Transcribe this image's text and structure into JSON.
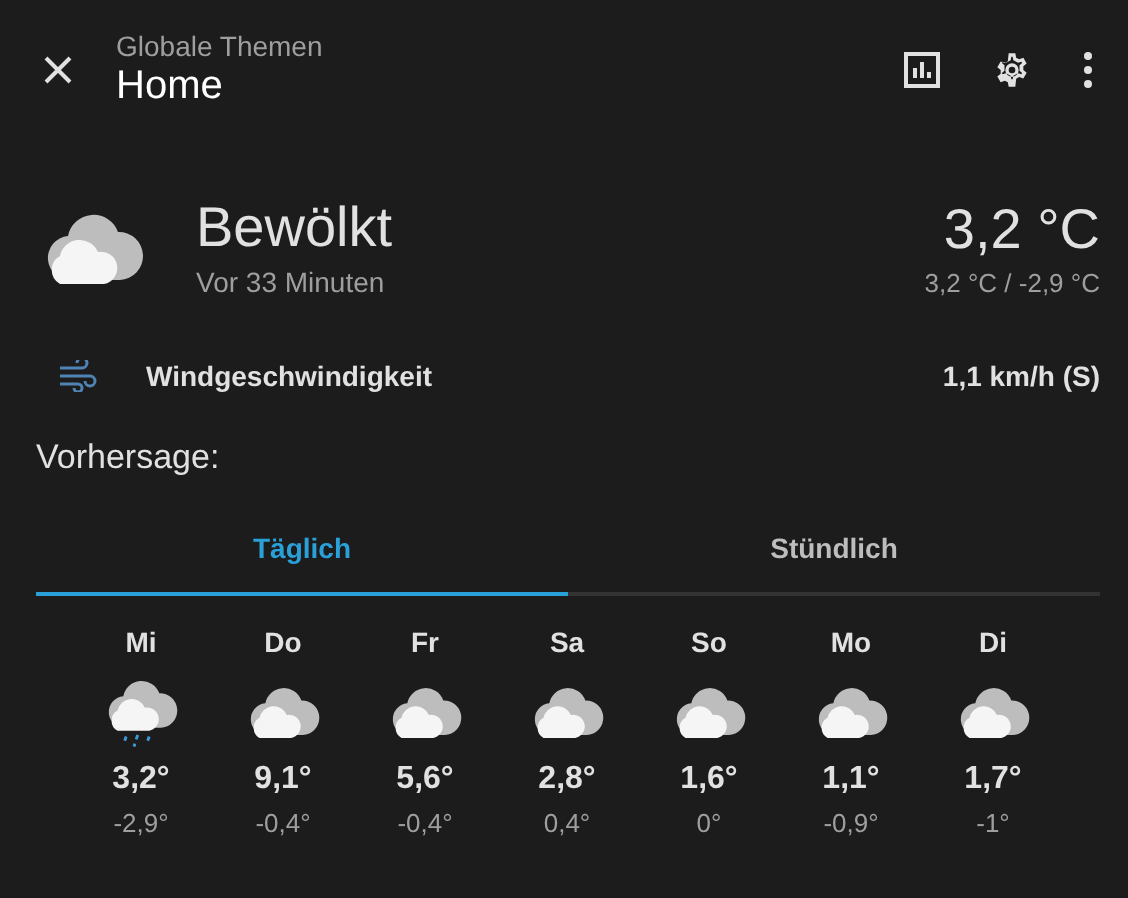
{
  "header": {
    "subtitle": "Globale Themen",
    "title": "Home"
  },
  "current": {
    "condition": "Bewölkt",
    "updated": "Vor 33 Minuten",
    "temperature": "3,2 °C",
    "range": "3,2 °C / -2,9 °C"
  },
  "attributes": [
    {
      "label": "Windgeschwindigkeit",
      "value": "1,1 km/h (S)"
    }
  ],
  "forecast_heading": "Vorhersage:",
  "tabs": [
    {
      "label": "Täglich",
      "selected": true
    },
    {
      "label": "Stündlich",
      "selected": false
    }
  ],
  "days": [
    {
      "day": "Mi",
      "kind": "rainy",
      "high": "3,2°",
      "low": "-2,9°"
    },
    {
      "day": "Do",
      "kind": "cloudy",
      "high": "9,1°",
      "low": "-0,4°"
    },
    {
      "day": "Fr",
      "kind": "cloudy",
      "high": "5,6°",
      "low": "-0,4°"
    },
    {
      "day": "Sa",
      "kind": "cloudy",
      "high": "2,8°",
      "low": "0,4°"
    },
    {
      "day": "So",
      "kind": "cloudy",
      "high": "1,6°",
      "low": "0°"
    },
    {
      "day": "Mo",
      "kind": "cloudy",
      "high": "1,1°",
      "low": "-0,9°"
    },
    {
      "day": "Di",
      "kind": "cloudy",
      "high": "1,7°",
      "low": "-1°"
    }
  ]
}
